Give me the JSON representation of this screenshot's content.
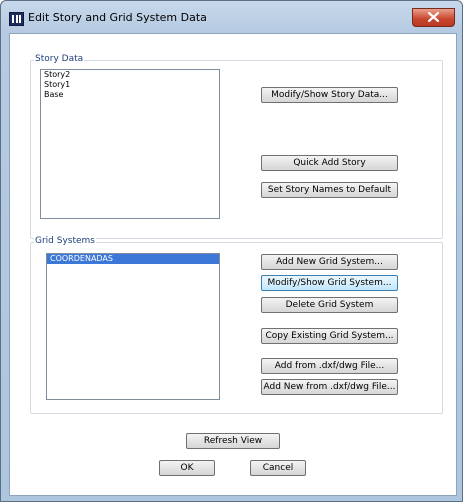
{
  "window": {
    "title": "Edit Story and Grid System Data",
    "close_symbol": "×"
  },
  "story_data": {
    "label": "Story Data",
    "items": [
      "Story2",
      "Story1",
      "Base"
    ],
    "buttons": {
      "modify_show": "Modify/Show Story Data...",
      "quick_add": "Quick Add Story",
      "set_names_default": "Set Story Names to Default"
    }
  },
  "grid_systems": {
    "label": "Grid Systems",
    "items": [
      "COORDENADAS"
    ],
    "selected_index": 0,
    "buttons": {
      "add_new": "Add New Grid System...",
      "modify_show": "Modify/Show Grid System...",
      "delete": "Delete Grid System",
      "copy_existing": "Copy Existing Grid System...",
      "add_from_dxf": "Add  from .dxf/dwg File...",
      "add_new_from_dxf": "Add New from .dxf/dwg File..."
    }
  },
  "footer": {
    "refresh": "Refresh View",
    "ok": "OK",
    "cancel": "Cancel"
  },
  "colors": {
    "title_bar": "#b6cbe2",
    "close_button": "#c8452c",
    "selection": "#3c78d8",
    "group_label": "#1f3f78"
  }
}
